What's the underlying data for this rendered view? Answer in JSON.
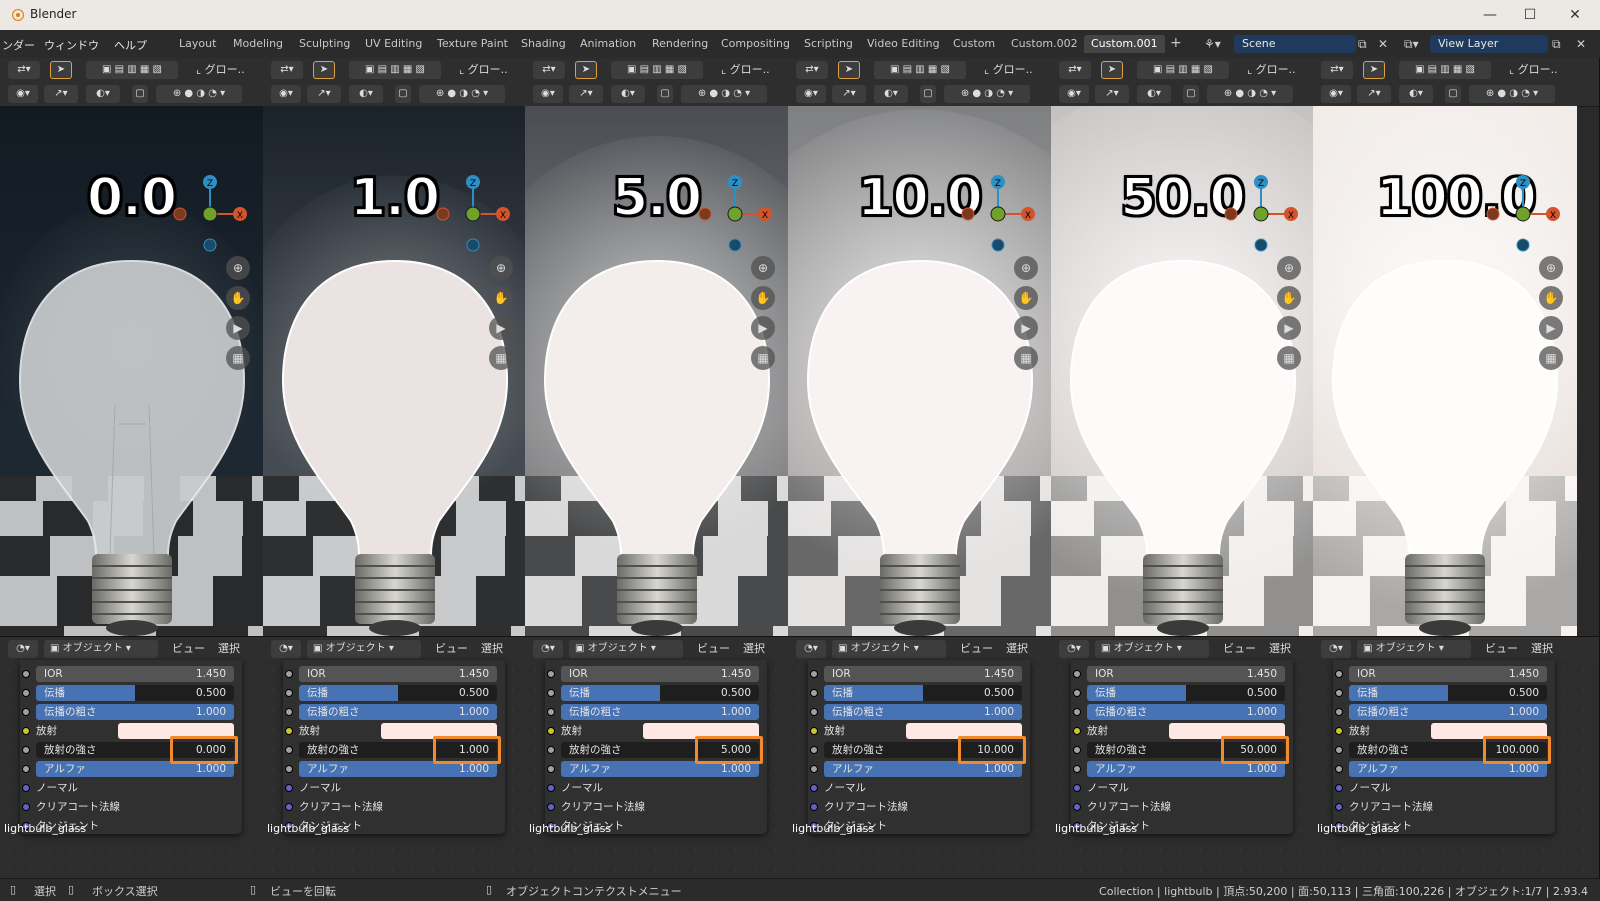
{
  "window": {
    "title": "Blender",
    "minimize": "—",
    "maximize": "☐",
    "close": "✕"
  },
  "menu": [
    "ンダー",
    "ウィンドウ",
    "ヘルプ"
  ],
  "workspaces": [
    {
      "label": "Layout"
    },
    {
      "label": "Modeling"
    },
    {
      "label": "Sculpting"
    },
    {
      "label": "UV Editing"
    },
    {
      "label": "Texture Paint"
    },
    {
      "label": "Shading"
    },
    {
      "label": "Animation"
    },
    {
      "label": "Rendering"
    },
    {
      "label": "Compositing"
    },
    {
      "label": "Scripting"
    },
    {
      "label": "Video Editing"
    },
    {
      "label": "Custom"
    },
    {
      "label": "Custom.002"
    },
    {
      "label": "Custom.001",
      "active": true
    }
  ],
  "add_workspace": "+",
  "scene": {
    "label": "Scene"
  },
  "view_layer": {
    "label": "View Layer"
  },
  "viewport_toolbar": {
    "transform": "グロー.."
  },
  "panels": [
    {
      "emission_label": "0.0",
      "emission_value": "0.000",
      "glow": 0.0
    },
    {
      "emission_label": "1.0",
      "emission_value": "1.000",
      "glow": 0.2
    },
    {
      "emission_label": "5.0",
      "emission_value": "5.000",
      "glow": 0.5
    },
    {
      "emission_label": "10.0",
      "emission_value": "10.000",
      "glow": 0.7
    },
    {
      "emission_label": "50.0",
      "emission_value": "50.000",
      "glow": 0.9
    },
    {
      "emission_label": "100.0",
      "emission_value": "100.000",
      "glow": 1.0
    }
  ],
  "node_header": {
    "mode": "オブジェクト",
    "view": "ビュー",
    "select": "選択"
  },
  "node": {
    "ior_label": "IOR",
    "ior_value": "1.450",
    "transmission_label": "伝播",
    "transmission_value": "0.500",
    "transmission_fraction": 0.5,
    "transmission_roughness_label": "伝播の粗さ",
    "transmission_roughness_value": "1.000",
    "emission_label": "放射",
    "emission_strength_label": "放射の強さ",
    "alpha_label": "アルファ",
    "alpha_value": "1.000",
    "normal_label": "ノーマル",
    "clearcoat_normal_label": "クリアコート法線",
    "tangent_label": "タンジェント",
    "material_name": "lightbulb_glass",
    "emission_color": "#fde8e4",
    "highlight_color": "#f08a2c"
  },
  "gizmo_axes": {
    "z": "Z",
    "x": "X"
  },
  "statusbar": {
    "select": "選択",
    "box_select": "ボックス選択",
    "rotate_view": "ビューを回転",
    "context_menu": "オブジェクトコンテクストメニュー",
    "stats": "Collection | lightbulb | 頂点:50,200 | 面:50,113 | 三角面:100,226 | オブジェクト:1/7 | 2.93.4"
  }
}
